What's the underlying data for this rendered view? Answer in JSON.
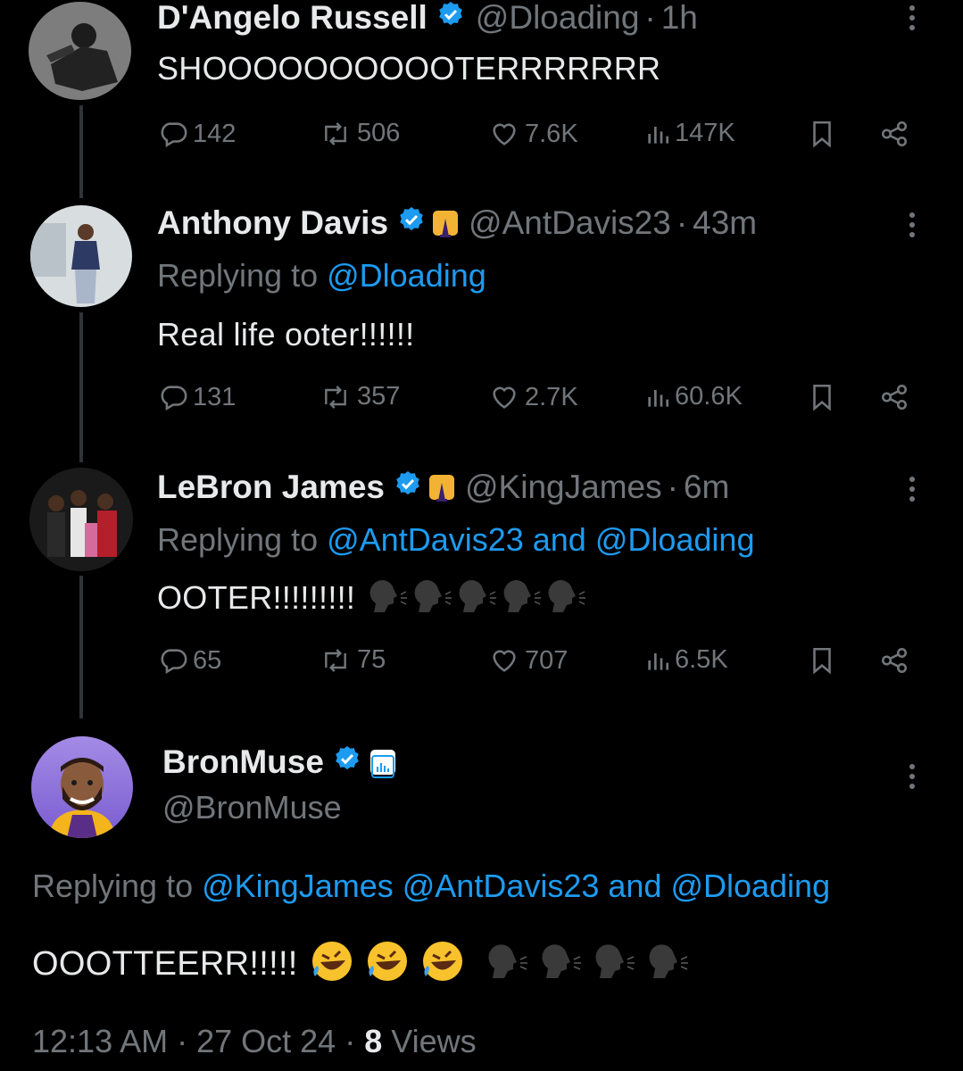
{
  "tweets": [
    {
      "name": "D'Angelo Russell",
      "handle": "@Dloading",
      "time": "1h",
      "text": "SHOOOOOOOOOOTERRRRRRR",
      "stats": {
        "replies": "142",
        "reposts": "506",
        "likes": "7.6K",
        "views": "147K"
      }
    },
    {
      "name": "Anthony Davis",
      "handle": "@AntDavis23",
      "time": "43m",
      "replying_prefix": "Replying to ",
      "replying_to": "@Dloading",
      "text": "Real life ooter!!!!!!",
      "stats": {
        "replies": "131",
        "reposts": "357",
        "likes": "2.7K",
        "views": "60.6K"
      }
    },
    {
      "name": "LeBron James",
      "handle": "@KingJames",
      "time": "6m",
      "replying_prefix": "Replying to ",
      "replying_to": "@AntDavis23 and @Dloading",
      "text": "OOTER!!!!!!!!!",
      "stats": {
        "replies": "65",
        "reposts": "75",
        "likes": "707",
        "views": "6.5K"
      }
    }
  ],
  "main_tweet": {
    "name": "BronMuse",
    "handle": "@BronMuse",
    "replying_prefix": "Replying to ",
    "replying_to": "@KingJames @AntDavis23 and @Dloading",
    "text": "OOOTTEERR!!!!!",
    "timestamp": "12:13 AM · 27 Oct 24 · ",
    "views_count": "8",
    "views_label": " Views"
  },
  "separator": "·",
  "colors": {
    "background": "#000000",
    "text": "#e7e9ea",
    "secondary": "#71767b",
    "link": "#1d9bf0",
    "verified": "#1d9bf0"
  }
}
